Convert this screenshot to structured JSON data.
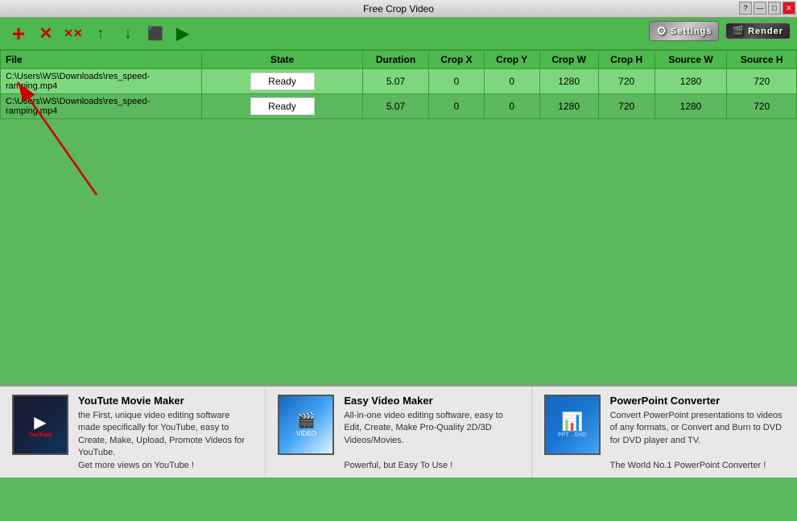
{
  "window": {
    "title": "Free Crop Video",
    "controls": [
      "?",
      "—",
      "□",
      "✕"
    ]
  },
  "toolbar": {
    "buttons": [
      {
        "name": "add",
        "icon": "+",
        "label": "Add File"
      },
      {
        "name": "remove",
        "icon": "✕",
        "label": "Remove File"
      },
      {
        "name": "clear",
        "icon": "✕✕",
        "label": "Clear All"
      },
      {
        "name": "move-up",
        "icon": "↑",
        "label": "Move Up"
      },
      {
        "name": "move-down",
        "icon": "↓",
        "label": "Move Down"
      },
      {
        "name": "crop-settings",
        "icon": "⬛",
        "label": "Crop Settings"
      },
      {
        "name": "play",
        "icon": "▶",
        "label": "Play"
      }
    ],
    "settings_label": "Settings",
    "render_label": "Render"
  },
  "table": {
    "columns": [
      "File",
      "State",
      "Duration",
      "Crop X",
      "Crop Y",
      "Crop W",
      "Crop H",
      "Source W",
      "Source H"
    ],
    "rows": [
      {
        "file": "C:\\Users\\WS\\Downloads\\res_speed-ramping.mp4",
        "state": "Ready",
        "duration": "5.07",
        "crop_x": "0",
        "crop_y": "0",
        "crop_w": "1280",
        "crop_h": "720",
        "source_w": "1280",
        "source_h": "720",
        "selected": true
      },
      {
        "file": "C:\\Users\\WS\\Downloads\\res_speed-ramping.mp4",
        "state": "Ready",
        "duration": "5.07",
        "crop_x": "0",
        "crop_y": "0",
        "crop_w": "1280",
        "crop_h": "720",
        "source_w": "1280",
        "source_h": "720",
        "selected": false
      }
    ]
  },
  "ads": [
    {
      "title": "YouTute Movie Maker",
      "description": "the First, unique video editing software made specifically for YouTube, easy to Create, Make, Upload, Promote Videos for YouTube.\nGet more views on YouTube !",
      "thumb_type": "youtube"
    },
    {
      "title": "Easy Video Maker",
      "description": "All-in-one video editing software, easy to Edit, Create, Make Pro-Quality 2D/3D Videos/Movies.\n\nPowerful, but Easy To Use !",
      "thumb_type": "video"
    },
    {
      "title": "PowerPoint Converter",
      "description": "Convert PowerPoint presentations to videos of any formats, or Convert and Burn to DVD for DVD player and TV.\n\nThe World No.1 PowerPoint Converter !",
      "thumb_type": "ppt"
    }
  ]
}
